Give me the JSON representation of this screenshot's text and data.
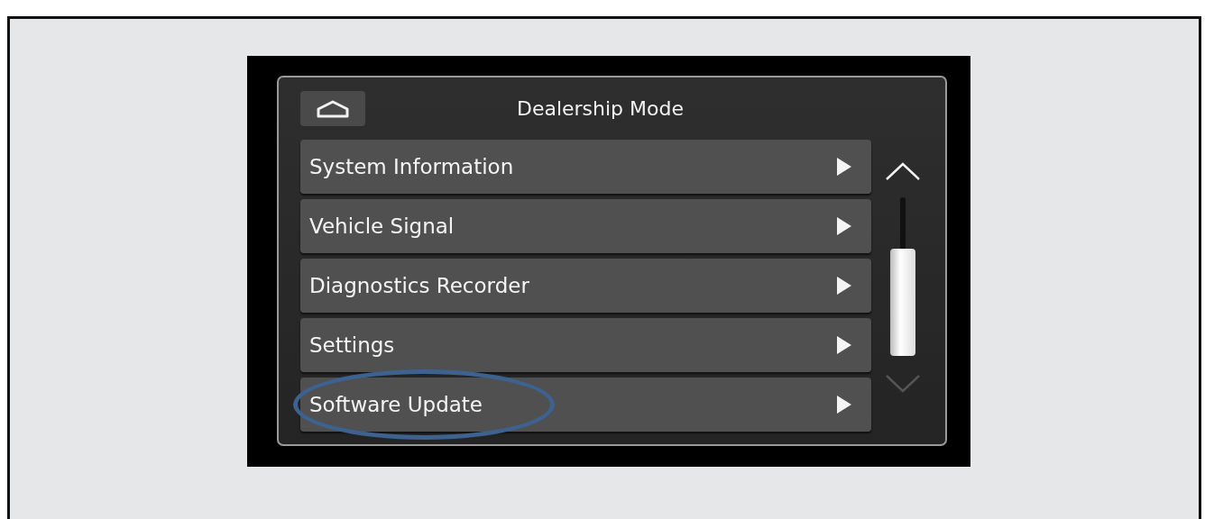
{
  "screen": {
    "title": "Dealership Mode",
    "menu_items": [
      {
        "label": "System Information",
        "highlighted": false
      },
      {
        "label": "Vehicle Signal",
        "highlighted": false
      },
      {
        "label": "Diagnostics Recorder",
        "highlighted": false
      },
      {
        "label": "Settings",
        "highlighted": false
      },
      {
        "label": "Software Update",
        "highlighted": true
      }
    ],
    "scroll_up": {
      "disabled": false
    },
    "scroll_down": {
      "disabled": true
    }
  }
}
